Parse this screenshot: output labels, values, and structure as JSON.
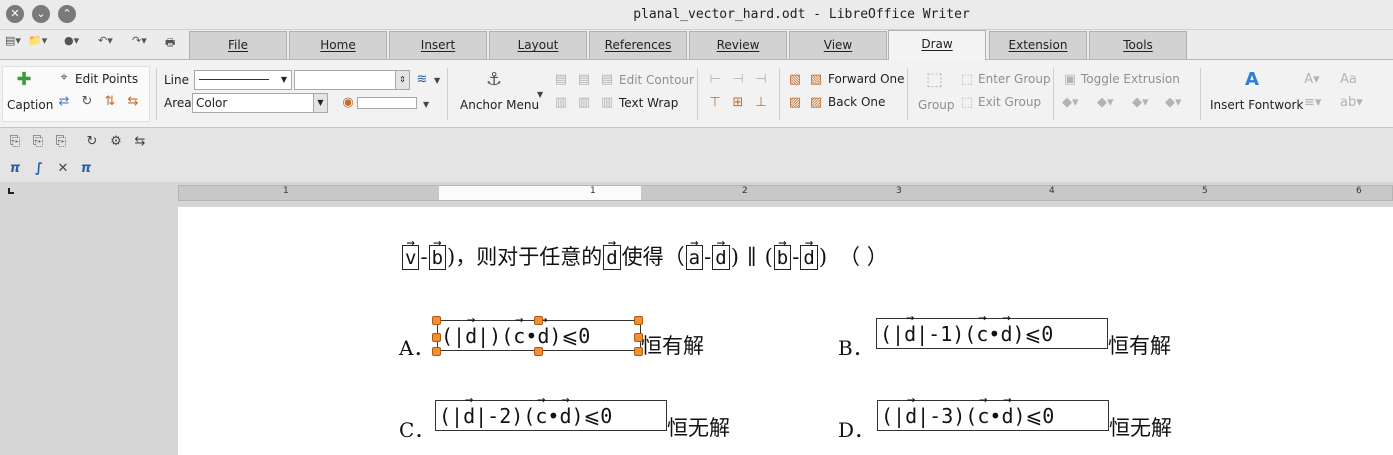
{
  "window": {
    "title": "planal_vector_hard.odt - LibreOffice Writer",
    "buttons": [
      "✕",
      "⌄",
      "⌃"
    ]
  },
  "tabs": [
    {
      "label": "File"
    },
    {
      "label": "Home"
    },
    {
      "label": "Insert"
    },
    {
      "label": "Layout"
    },
    {
      "label": "References"
    },
    {
      "label": "Review"
    },
    {
      "label": "View"
    },
    {
      "label": "Draw",
      "active": true
    },
    {
      "label": "Extension"
    },
    {
      "label": "Tools"
    }
  ],
  "ribbon": {
    "caption": "Caption",
    "edit_points": "Edit Points",
    "line_label": "Line",
    "area_label": "Area",
    "area_value": "Color",
    "anchor_menu": "Anchor Menu",
    "edit_contour": "Edit Contour",
    "text_wrap": "Text Wrap",
    "forward_one": "Forward One",
    "back_one": "Back One",
    "group": "Group",
    "enter_group": "Enter Group",
    "exit_group": "Exit Group",
    "toggle_extrusion": "Toggle Extrusion",
    "insert_fontwork": "Insert Fontwork"
  },
  "ruler": {
    "numbers": [
      "1",
      "1",
      "2",
      "3",
      "4",
      "5",
      "6"
    ]
  },
  "document": {
    "line1": {
      "v": "v",
      "b": "b",
      "text1": "，则对于任意的",
      "d": "d",
      "text2": "使得",
      "a": "a",
      "paren_close": ")",
      "parallel": "∥",
      "answer": "（      ）"
    },
    "options": [
      {
        "label": "A．",
        "expr_left": "(|",
        "d": "d",
        "expr_mid": "|)(",
        "c": "c",
        "dot": "•",
        "expr_end": ")⩽0",
        "suffix": "恒有解"
      },
      {
        "label": "B．",
        "expr_left": "(|",
        "d": "d",
        "expr_mid": "|-1)(",
        "c": "c",
        "dot": "•",
        "expr_end": ")⩽0",
        "suffix": "恒有解"
      },
      {
        "label": "C．",
        "expr_left": "(|",
        "d": "d",
        "expr_mid": "|-2)(",
        "c": "c",
        "dot": "•",
        "expr_end": ")⩽0",
        "suffix": "恒无解"
      },
      {
        "label": "D．",
        "expr_left": "(|",
        "d": "d",
        "expr_mid": "|-3)(",
        "c": "c",
        "dot": "•",
        "expr_end": ")⩽0",
        "suffix": "恒无解"
      }
    ],
    "minus": "-"
  }
}
